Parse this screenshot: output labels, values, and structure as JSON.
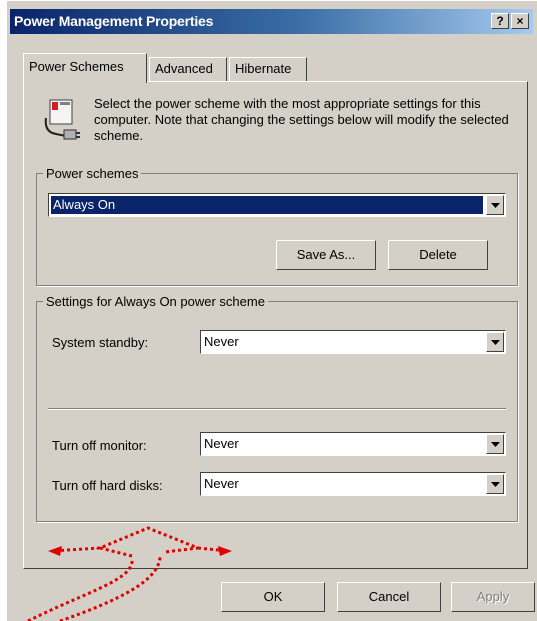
{
  "window": {
    "title": "Power Management Properties",
    "help_button": "?",
    "close_button": "×"
  },
  "tabs": [
    {
      "label": "Power Schemes",
      "active": true
    },
    {
      "label": "Advanced",
      "active": false
    },
    {
      "label": "Hibernate",
      "active": false
    }
  ],
  "intro": {
    "text": "Select the power scheme with the most appropriate settings for this computer. Note that changing the settings below will modify the selected scheme."
  },
  "power_schemes": {
    "legend": "Power schemes",
    "selected": "Always On",
    "save_as_label": "Save As...",
    "delete_label": "Delete"
  },
  "settings": {
    "legend": "Settings for Always On power scheme",
    "system_standby": {
      "label": "System standby:",
      "value": "Never"
    },
    "turn_off_monitor": {
      "label": "Turn off monitor:",
      "value": "Never"
    },
    "turn_off_hard_disks": {
      "label": "Turn off hard disks:",
      "value": "Never"
    }
  },
  "footer": {
    "ok_label": "OK",
    "cancel_label": "Cancel",
    "apply_label": "Apply"
  },
  "colors": {
    "annotation_arrow": "#e00000",
    "title_bar": "#0a246a"
  }
}
